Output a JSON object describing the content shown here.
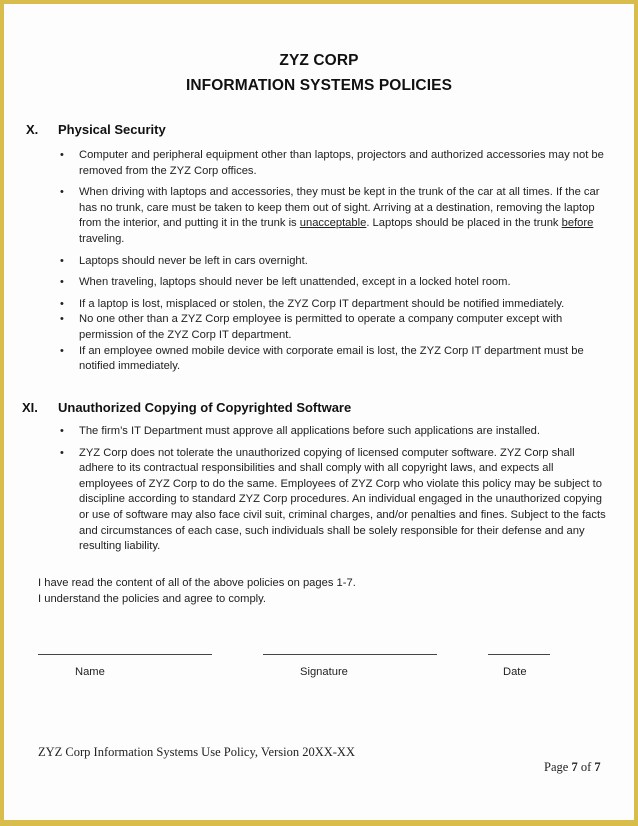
{
  "header": {
    "company": "ZYZ CORP",
    "title": "INFORMATION SYSTEMS POLICIES"
  },
  "sections": [
    {
      "number": "X.",
      "title": "Physical Security",
      "bullets": [
        "Computer and peripheral equipment other than laptops, projectors and authorized accessories may not be removed from the ZYZ Corp offices.",
        {
          "before": "When driving with laptops and accessories, they must be kept in the trunk of the car at all times.  If the car has no trunk, care must be taken to keep them out of sight.  Arriving at a destination, removing the laptop from the interior, and putting it in the trunk is ",
          "emph1": "unacceptable",
          "middle": ".  Laptops should be placed in the trunk ",
          "emph2": "before",
          "after": " traveling."
        },
        "Laptops should never be left in cars overnight.",
        "When traveling, laptops should never be left unattended, except in a locked hotel room.",
        "If a laptop is lost, misplaced or stolen, the ZYZ Corp IT department should be notified immediately.",
        "No one other than a ZYZ Corp employee is permitted to operate a company computer except with permission of the ZYZ Corp IT department.",
        "If an employee owned mobile device with corporate email is lost, the ZYZ Corp IT department must be notified immediately."
      ]
    },
    {
      "number": "XI.",
      "title": "Unauthorized Copying of Copyrighted Software",
      "bullets": [
        "The firm’s IT Department must approve all applications before such applications are installed.",
        "ZYZ Corp does not tolerate the unauthorized copying of licensed computer software.  ZYZ Corp shall adhere to its contractual responsibilities and shall comply with all copyright laws, and expects all employees of ZYZ Corp to do the same. Employees of ZYZ Corp who violate this policy may be subject to discipline according to standard ZYZ Corp procedures. An individual engaged in the unauthorized copying or use of software may also face civil suit, criminal charges, and/or penalties and fines. Subject to the facts and circumstances of each case, such individuals shall be solely responsible for their defense and any resulting liability."
      ]
    }
  ],
  "acknowledgement": {
    "line1": "I have read the content of all of the above policies on pages 1-7.",
    "line2": "I understand the policies and agree to comply."
  },
  "signature": {
    "name_label": "Name",
    "signature_label": "Signature",
    "date_label": "Date"
  },
  "footer": {
    "doc_title": "ZYZ Corp Information Systems Use Policy, Version 20XX-XX",
    "page_prefix": "Page ",
    "page_current": "7",
    "page_of": " of ",
    "page_total": "7"
  },
  "bullet_glyph": "•"
}
